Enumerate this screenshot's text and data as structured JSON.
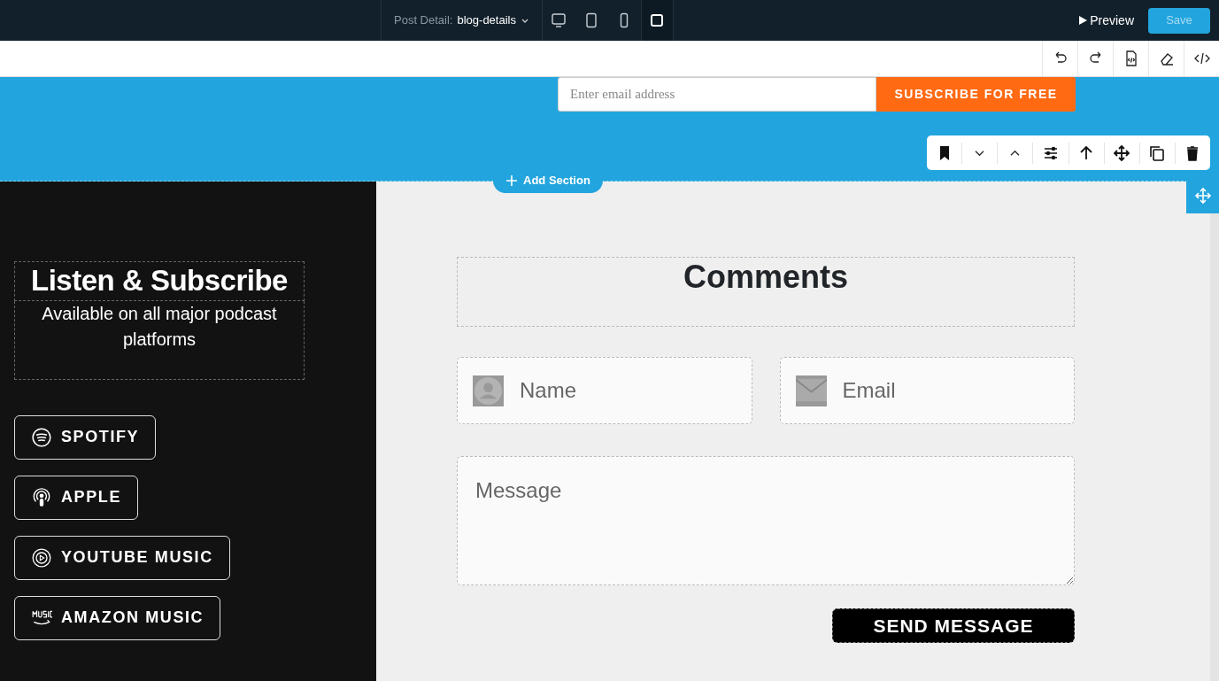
{
  "topbar": {
    "page_label": "Post Detail:",
    "page_value": "blog-details",
    "devices": [
      {
        "kind": "desktop",
        "selected": false
      },
      {
        "kind": "tablet",
        "selected": false
      },
      {
        "kind": "mobile",
        "selected": false
      },
      {
        "kind": "custom",
        "selected": true
      }
    ],
    "preview": "Preview",
    "save": "Save",
    "save_disabled": true
  },
  "newsletter": {
    "placeholder": "Enter email address",
    "button": "SUBSCRIBE FOR FREE"
  },
  "add_section": "Add Section",
  "podcast": {
    "title": "Listen & Subscribe",
    "subtitle": "Available on all major podcast platforms",
    "platforms": [
      {
        "kind": "spotify",
        "label": "SPOTIFY"
      },
      {
        "kind": "apple",
        "label": "APPLE"
      },
      {
        "kind": "youtube",
        "label": "YOUTUBE MUSIC"
      },
      {
        "kind": "amazon",
        "label": "AMAZON MUSIC"
      }
    ]
  },
  "comments": {
    "title": "Comments",
    "fields": [
      {
        "kind": "name",
        "placeholder": "Name"
      },
      {
        "kind": "email",
        "placeholder": "Email"
      }
    ],
    "message_placeholder": "Message",
    "submit": "SEND MESSAGE"
  }
}
